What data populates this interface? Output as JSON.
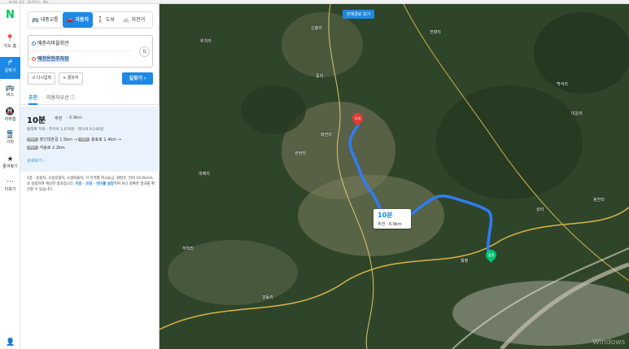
{
  "topbar": {
    "text": "· 네이버 지도 · 즐겨찾기 · 메뉴 ·"
  },
  "rail": {
    "logo": "N",
    "items": [
      {
        "label": "지도 홈",
        "icon": "📍"
      },
      {
        "label": "길찾기",
        "icon": "↱"
      },
      {
        "label": "버스",
        "icon": "🚌"
      },
      {
        "label": "지하철",
        "icon": "🚇"
      },
      {
        "label": "기차",
        "icon": "🚆"
      },
      {
        "label": "즐겨찾기",
        "icon": "★"
      },
      {
        "label": "더보기",
        "icon": "···"
      }
    ],
    "user_icon": "👤"
  },
  "modes": [
    {
      "label": "대중교통",
      "icon": "🚌"
    },
    {
      "label": "자동차",
      "icon": "🚗"
    },
    {
      "label": "도보",
      "icon": "🚶"
    },
    {
      "label": "자전거",
      "icon": "🚲"
    }
  ],
  "route": {
    "origin": "매촌리마을회관",
    "destination": "예천온천주차장",
    "swap_icon": "⇅",
    "reset_label": "다시입력",
    "waypoint_label": "+ 경유지",
    "search_label": "길찾기 ›"
  },
  "tabs": [
    "추천",
    "미용자우선 ⓘ"
  ],
  "result": {
    "time": "10분",
    "tag": "추천",
    "distance": "· 6.9km",
    "fare": "통행료 무료 · 주유비 1,070원 · 택시비 9,160원",
    "roads": [
      {
        "pill": "지방도",
        "text": "장신대촌길 1.5km →",
        "pill2": "지방도",
        "text2": "충효로 1.4km →"
      },
      {
        "pill": "지방도",
        "text": "석송로 2.2km",
        "pill2": "",
        "text2": ""
      }
    ],
    "more": "상세보기 ›"
  },
  "notice": {
    "prefix": "1종 - 승용차, 소형승합차, 소형화물차, 각 지역별 택시요금, 휘발유, 연비 10.5km/L로 설정하여 계산한 결과입니다.",
    "link": "차종 · 유종 · 연비를 설정",
    "suffix": "하여 보다 정확한 결과를 확인할 수 있습니다."
  },
  "map": {
    "banner": "전체경로 보기",
    "tooltip_time": "10분",
    "tooltip_info": "추천 · 6.9km",
    "pin_dest": "도착",
    "pin_start": "출발",
    "labels": [
      "위치리",
      "신흥리",
      "천향리",
      "대제리",
      "화전리",
      "중리",
      "백석리",
      "하학리",
      "상리",
      "월평",
      "용천리",
      "미운리",
      "강동리",
      "관현리"
    ],
    "watermark": "Windows"
  }
}
